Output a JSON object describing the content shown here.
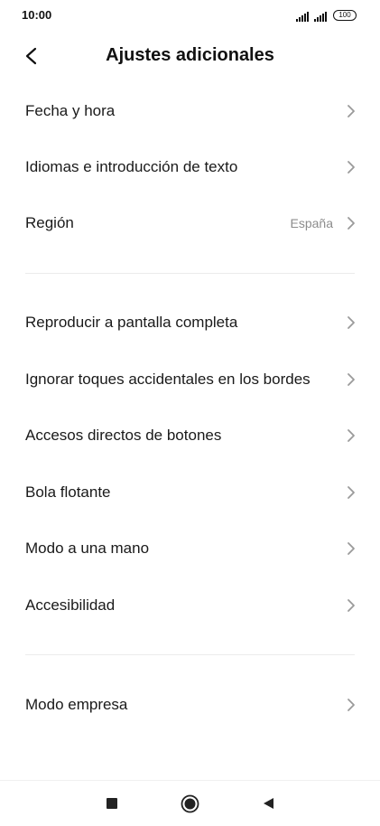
{
  "status_bar": {
    "time": "10:00",
    "battery": "100",
    "icons": [
      "signal-icon",
      "signal-icon",
      "battery-icon"
    ]
  },
  "header": {
    "title": "Ajustes adicionales",
    "back_icon": "chevron-left-icon"
  },
  "sections": [
    {
      "items": [
        {
          "label": "Fecha y hora",
          "value": ""
        },
        {
          "label": "Idiomas e introducción de texto",
          "value": ""
        },
        {
          "label": "Región",
          "value": "España"
        }
      ]
    },
    {
      "items": [
        {
          "label": "Reproducir a pantalla completa",
          "value": ""
        },
        {
          "label": "Ignorar toques accidentales en los bordes",
          "value": ""
        },
        {
          "label": "Accesos directos de botones",
          "value": ""
        },
        {
          "label": "Bola flotante",
          "value": ""
        },
        {
          "label": "Modo a una mano",
          "value": ""
        },
        {
          "label": "Accesibilidad",
          "value": ""
        }
      ]
    },
    {
      "items": [
        {
          "label": "Modo empresa",
          "value": ""
        }
      ]
    }
  ],
  "nav_bar": {
    "icons": [
      "recents-square-icon",
      "home-circle-icon",
      "back-triangle-icon"
    ]
  },
  "colors": {
    "text": "#1a1a1a",
    "secondary_text": "#8c8c8c",
    "chevron": "#9a9a9a",
    "divider": "#ececec"
  }
}
